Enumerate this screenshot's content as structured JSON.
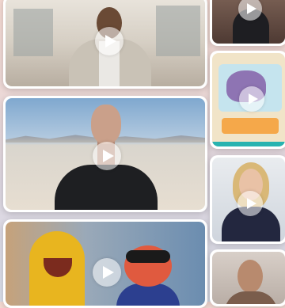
{
  "gallery": {
    "videos": [
      {
        "id": "main-1",
        "play_icon": "play-icon"
      },
      {
        "id": "main-2",
        "play_icon": "play-icon"
      },
      {
        "id": "main-3",
        "play_icon": "play-icon"
      },
      {
        "id": "side-1",
        "play_icon": "play-icon"
      },
      {
        "id": "side-2",
        "play_icon": "play-icon"
      },
      {
        "id": "side-3",
        "play_icon": "play-icon"
      },
      {
        "id": "side-4",
        "play_icon": "play-icon"
      }
    ]
  },
  "colors": {
    "card_border": "#ffffff",
    "play_button": "rgba(255,255,255,0.55)",
    "play_glyph": "#ffffff"
  }
}
